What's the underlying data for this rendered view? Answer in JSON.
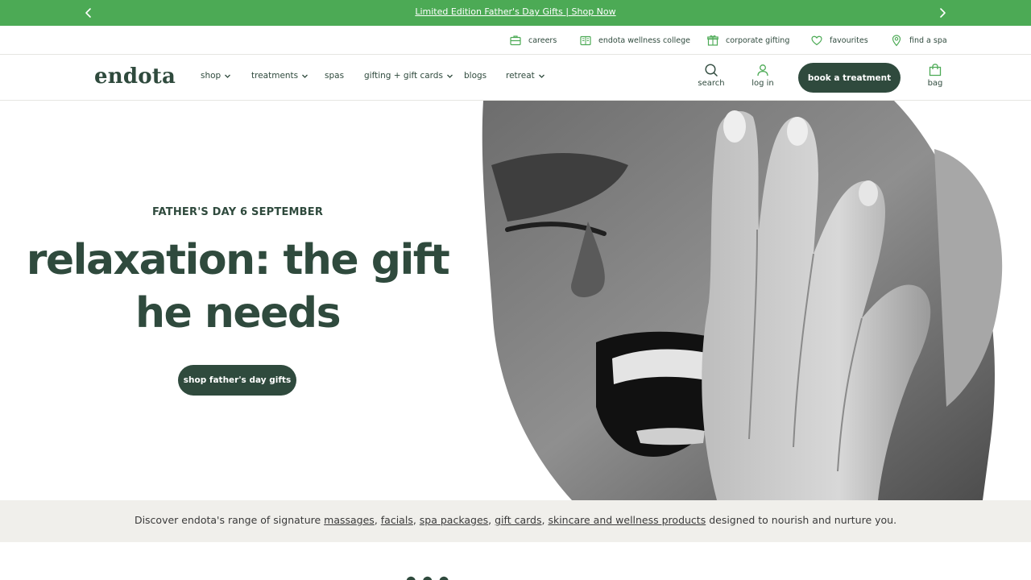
{
  "promo": {
    "text": "Limited Edition Father's Day Gifts | Shop Now",
    "prev_icon": "chevron-left-icon",
    "next_icon": "chevron-right-icon"
  },
  "utility": {
    "items": [
      {
        "label": "careers",
        "icon": "briefcase-icon"
      },
      {
        "label": "endota wellness college",
        "icon": "book-icon"
      },
      {
        "label": "corporate gifting",
        "icon": "gift-icon"
      },
      {
        "label": "favourites",
        "icon": "heart-icon"
      },
      {
        "label": "find a spa",
        "icon": "location-pin-icon"
      }
    ]
  },
  "nav": {
    "logo": "endota",
    "items": [
      {
        "label": "shop",
        "dropdown": true
      },
      {
        "label": "treatments",
        "dropdown": true
      },
      {
        "label": "spas",
        "dropdown": false
      },
      {
        "label": "gifting + gift cards",
        "dropdown": true
      },
      {
        "label": "blogs",
        "dropdown": false
      },
      {
        "label": "retreat",
        "dropdown": true
      }
    ],
    "search_label": "search",
    "login_label": "log in",
    "book_label": "book a treatment",
    "bag_label": "bag"
  },
  "hero": {
    "eyebrow": "FATHER'S DAY 6 SEPTEMBER",
    "headline_line1": "relaxation: the gift",
    "headline_line2": "he needs",
    "cta_label": "shop father's day gifts"
  },
  "discover": {
    "prefix": "Discover endota's range of signature ",
    "link1": "massages",
    "sep1": ", ",
    "link2": "facials",
    "sep2": ", ",
    "link3": "spa packages",
    "sep3": ", ",
    "link4": "gift cards",
    "sep4": ", ",
    "link5": "skincare and wellness products",
    "suffix": " designed to nourish and nurture you."
  },
  "colors": {
    "brand_green": "#2f4a3d",
    "promo_green": "#4caa55",
    "strip_bg": "#f0efeb"
  }
}
